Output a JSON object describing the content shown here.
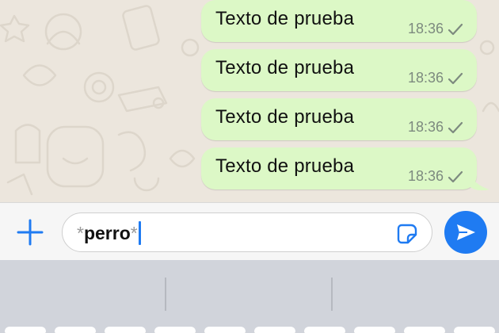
{
  "messages": [
    {
      "text": "Texto de prueba",
      "time": "18:36"
    },
    {
      "text": "Texto de prueba",
      "time": "18:36"
    },
    {
      "text": "Texto de prueba",
      "time": "18:36"
    },
    {
      "text": "Texto de prueba",
      "time": "18:36"
    }
  ],
  "composer": {
    "asterisk_open": "*",
    "word": "perro",
    "asterisk_close": "*"
  },
  "colors": {
    "outgoing_bubble": "#dcf8c6",
    "accent": "#1f7bf2",
    "chat_background": "#ece6dd",
    "keyboard_background": "#d1d4db"
  },
  "icons": {
    "add": "plus-icon",
    "sticker": "sticker-icon",
    "send": "send-icon",
    "delivered": "single-check-icon"
  }
}
